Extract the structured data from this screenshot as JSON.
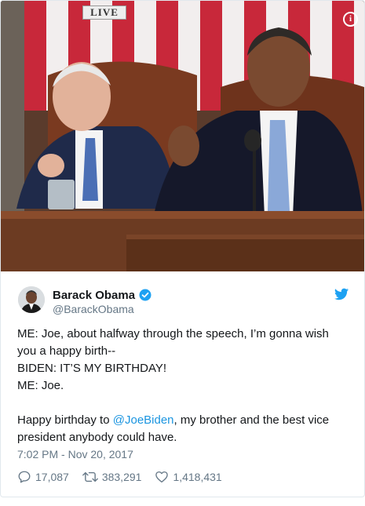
{
  "media": {
    "live_label": "LIVE",
    "info_icon": "info-icon"
  },
  "author": {
    "display_name": "Barack Obama",
    "handle": "@BarackObama",
    "verified_icon": "verified-badge-icon",
    "platform_icon": "twitter-bird-icon"
  },
  "tweet": {
    "text_before_mention": "ME: Joe, about halfway through the speech, I’m gonna wish you a happy birth--\nBIDEN: IT’S MY BIRTHDAY!\nME: Joe.\n\nHappy birthday to ",
    "mention": "@JoeBiden",
    "text_after_mention": ", my brother and the best vice president anybody could have.",
    "timestamp": "7:02 PM - Nov 20, 2017"
  },
  "actions": {
    "replies": "17,087",
    "retweets": "383,291",
    "likes": "1,418,431"
  },
  "colors": {
    "link": "#1b95e0",
    "secondary_text": "#657786",
    "primary_text": "#14171a",
    "verified": "#1da1f2"
  }
}
